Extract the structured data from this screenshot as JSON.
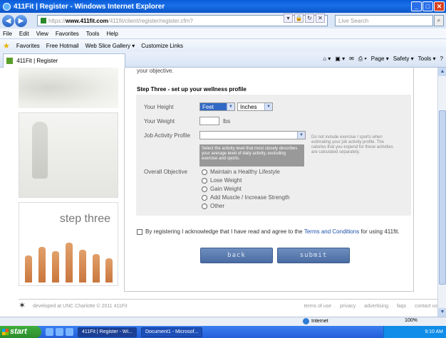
{
  "window": {
    "title": "411Fit | Register - Windows Internet Explorer",
    "min": "_",
    "max": "□",
    "close": "✕"
  },
  "address": {
    "prefix": "https://",
    "domain": "www.411fit.com",
    "path": "/411fit/client/register/register.cfm?",
    "search_placeholder": "Live Search"
  },
  "menu": [
    "File",
    "Edit",
    "View",
    "Favorites",
    "Tools",
    "Help"
  ],
  "favorites": {
    "label": "Favorites",
    "items": [
      "Free Hotmail",
      "Web Slice Gallery ▾",
      "Customize Links"
    ]
  },
  "tab": {
    "label": "411Fit | Register"
  },
  "commands": [
    "Page ▾",
    "Safety ▾",
    "Tools ▾"
  ],
  "page": {
    "cut_text": "your objective.",
    "step_heading": "Step Three - set up your wellness profile",
    "fields": {
      "height_label": "Your Height",
      "height_unit1": "Feet",
      "height_unit2": "Inches",
      "weight_label": "Your Weight",
      "weight_unit": "lbs",
      "job_label": "Job Activity Profile",
      "job_hint": "Select the activity level that most closely describes your average level of daily activity, excluding exercise and sports.",
      "job_note": "Do not include exercise / sports when estimating your job activity profile. The calories that you expend for these activities are calculated separately.",
      "objective_label": "Overall Objective",
      "objectives": [
        "Maintain a Healthy Lifestyle",
        "Lose Weight",
        "Gain Weight",
        "Add Muscle / Increase Strength",
        "Other"
      ]
    },
    "agree_text_pre": "By registering I acknowledge that I have read and agree to the",
    "agree_link": "Terms and Conditions",
    "agree_text_post": "for using 411fit.",
    "back_button": "back",
    "submit_button": "submit",
    "side_label": "step three"
  },
  "footer": {
    "credit": "developed at UNC Charlotte   © 2011 411Fit",
    "links": [
      "terms of use",
      "privacy",
      "advertising",
      "faqs",
      "contact us"
    ]
  },
  "status": {
    "zone": "Internet",
    "zoom": "100%"
  },
  "taskbar": {
    "start": "start",
    "tasks": [
      "411Fit | Register - Wi...",
      "Document1 - Microsof..."
    ],
    "clock": "9:10 AM"
  }
}
